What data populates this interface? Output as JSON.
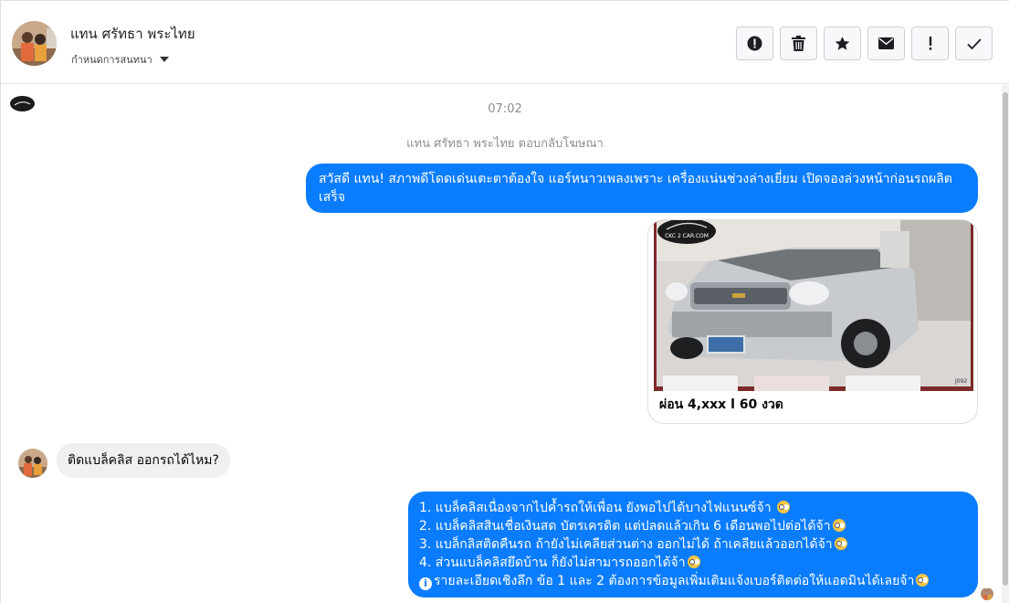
{
  "header": {
    "contact_name": "แทน ศรัทธา พระไทย",
    "thread_label": "กำหนดการสนทนา",
    "toolbar": [
      {
        "name": "report-button",
        "icon": "alert-circle-icon"
      },
      {
        "name": "delete-button",
        "icon": "trash-icon"
      },
      {
        "name": "star-button",
        "icon": "star-icon"
      },
      {
        "name": "mark-unread-button",
        "icon": "envelope-icon"
      },
      {
        "name": "important-button",
        "icon": "exclamation-icon"
      },
      {
        "name": "done-button",
        "icon": "checkmark-icon"
      }
    ]
  },
  "conversation": {
    "timestamp": "07:02",
    "meta_note": "แทน ศรัทธา พระไทย ตอบกลับโฆษณา",
    "outgoing_1": "สวัสดี แทน! สภาพดีโดดเด่นเตะตาต้องใจ แอร์หนาวเพลงเพราะ เครื่องแน่นช่วงล่างเยี่ยม เปิดจองล่วงหน้าก่อนรถผลิตเสร็จ",
    "ad_card": {
      "caption": "ผ่อน 4,xxx l 60 งวด",
      "watermark": "CKC 2 CAR.COM",
      "plate_code": "J092"
    },
    "incoming_1": "ติดแบล็คลิส ออกรถได้ไหม?",
    "outgoing_2": {
      "line1": "1. แบล็คลิสเนื่องจากไปค้ำรถให้เพื่อน ยังพอไปได้บางไฟแนนซ์จ้า",
      "line2": "2. แบล็คลิสสินเชื่อเงินสด บัตรเครดิต แต่ปลดแล้วเกิน 6 เดือนพอไปต่อได้จ้า",
      "line3": "3. แบล็กลิสติดคืนรถ ถ้ายังไม่เคลียส่วนต่าง ออกไม่ได้ ถ้าเคลียแล้วออกได้จ้า",
      "line4": "4. ส่วนแบล็คลิสยึดบ้าน ก็ยังไม่สามารถออกได้จ้า",
      "line5": "รายละเอียดเชิงลึก ข้อ 1 และ 2 ต้องการข้อมูลเพิ่มเติมแจ้งเบอร์ติดต่อให้แอดมินได้เลยจ้า"
    }
  },
  "colors": {
    "accent": "#0a7cff",
    "incoming_bubble": "#f0f0f0",
    "meta_text": "#8a8d91"
  }
}
